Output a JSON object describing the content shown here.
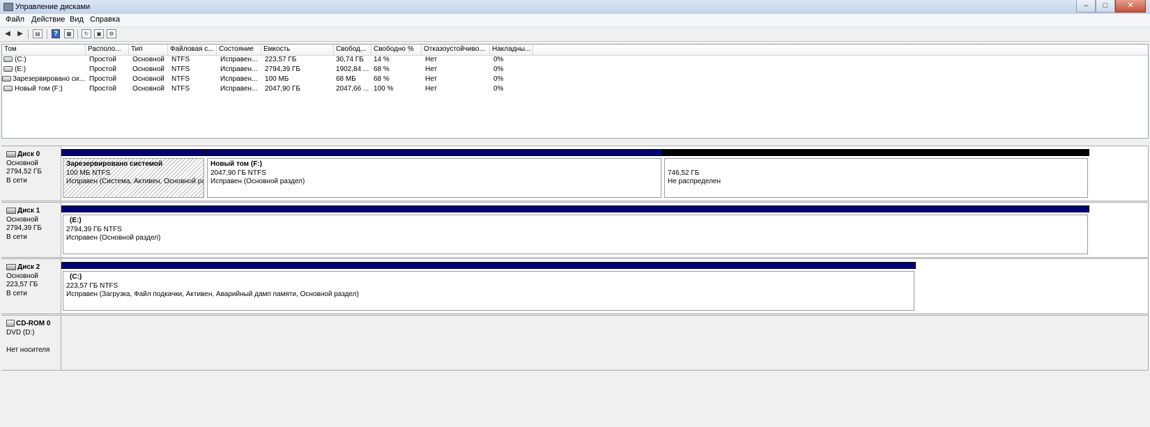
{
  "window": {
    "title": "Управление дисками"
  },
  "menu": [
    "Файл",
    "Действие",
    "Вид",
    "Справка"
  ],
  "icons": {
    "back": "arrow-left-icon",
    "forward": "arrow-right-icon",
    "properties": "properties-icon",
    "help": "help-icon",
    "list": "list-icon",
    "refresh": "refresh-icon",
    "rescan": "rescan-icon",
    "settings": "settings-icon"
  },
  "volume_list": {
    "columns": [
      "Том",
      "Располо...",
      "Тип",
      "Файловая с...",
      "Состояние",
      "Емкость",
      "Свобод...",
      "Свободно %",
      "Отказоустойчиво...",
      "Накладны..."
    ],
    "rows": [
      [
        "(C:)",
        "Простой",
        "Основной",
        "NTFS",
        "Исправен...",
        "223,57 ГБ",
        "30,74 ГБ",
        "14 %",
        "Нет",
        "0%"
      ],
      [
        "(E:)",
        "Простой",
        "Основной",
        "NTFS",
        "Исправен...",
        "2794,39 ГБ",
        "1902,84 ...",
        "68 %",
        "Нет",
        "0%"
      ],
      [
        "Зарезервировано си...",
        "Простой",
        "Основной",
        "NTFS",
        "Исправен...",
        "100 МБ",
        "68 МБ",
        "68 %",
        "Нет",
        "0%"
      ],
      [
        "Новый том (F:)",
        "Простой",
        "Основной",
        "NTFS",
        "Исправен...",
        "2047,90 ГБ",
        "2047,66 ...",
        "100 %",
        "Нет",
        "0%"
      ]
    ]
  },
  "disks": [
    {
      "name": "Диск 0",
      "type": "Основной",
      "size": "2794,52 ГБ",
      "status": "В сети",
      "partitions": [
        {
          "name": "Зарезервировано системой",
          "size": "100 МБ NTFS",
          "status": "Исправен (Система, Активен, Основной ра"
        },
        {
          "name": "Новый том  (F:)",
          "size": "2047,90 ГБ NTFS",
          "status": "Исправен (Основной раздел)"
        },
        {
          "name": "",
          "size": "746,52 ГБ",
          "status": "Не распределен"
        }
      ]
    },
    {
      "name": "Диск 1",
      "type": "Основной",
      "size": "2794,39 ГБ",
      "status": "В сети",
      "partitions": [
        {
          "name": "(E:)",
          "size": "2794,39 ГБ NTFS",
          "status": "Исправен (Основной раздел)"
        }
      ]
    },
    {
      "name": "Диск 2",
      "type": "Основной",
      "size": "223,57 ГБ",
      "status": "В сети",
      "partitions": [
        {
          "name": "(C:)",
          "size": "223,57 ГБ NTFS",
          "status": "Исправен (Загрузка, Файл подкачки, Активен, Аварийный дамп памяти, Основной раздел)"
        }
      ]
    }
  ],
  "cdrom": {
    "name": "CD-ROM 0",
    "drive": "DVD (D:)",
    "status": "Нет носителя"
  }
}
